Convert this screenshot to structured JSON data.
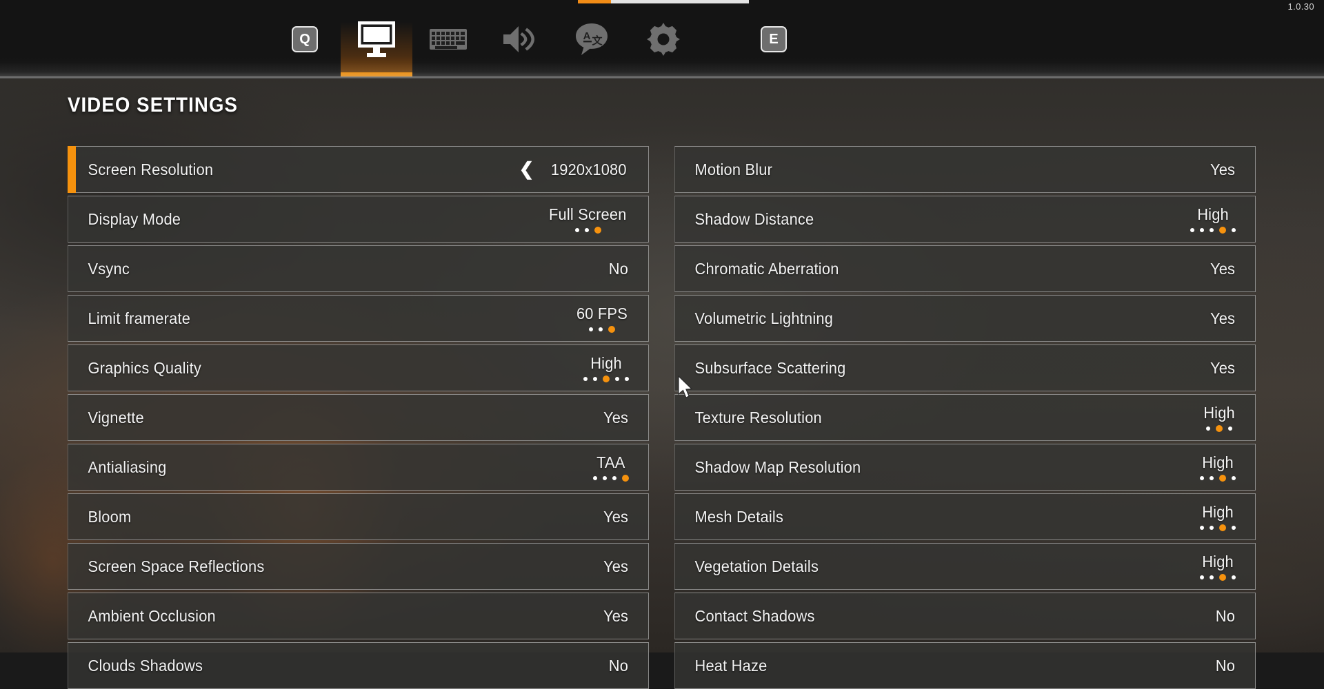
{
  "version": "1.0.30",
  "topbar": {
    "tabs": [
      {
        "name": "quit-keycap",
        "icon": "keycap-q",
        "label": "Q",
        "active": false
      },
      {
        "name": "tab-video",
        "icon": "monitor-icon",
        "label": "",
        "active": true
      },
      {
        "name": "tab-controls",
        "icon": "keyboard-icon",
        "label": "",
        "active": false
      },
      {
        "name": "tab-audio",
        "icon": "speaker-icon",
        "label": "",
        "active": false
      },
      {
        "name": "tab-language",
        "icon": "language-icon",
        "label": "",
        "active": false
      },
      {
        "name": "tab-gameplay",
        "icon": "gear-icon",
        "label": "",
        "active": false
      },
      {
        "name": "next-keycap",
        "icon": "keycap-e",
        "label": "E",
        "active": false
      }
    ]
  },
  "page": {
    "title": "VIDEO SETTINGS",
    "accent_color": "#f6920e",
    "left_column": [
      {
        "label": "Screen Resolution",
        "value": "1920x1080",
        "chevron": true,
        "selected": true,
        "dots": 0,
        "dot_index": 0
      },
      {
        "label": "Display Mode",
        "value": "Full Screen",
        "chevron": false,
        "selected": false,
        "dots": 3,
        "dot_index": 3
      },
      {
        "label": "Vsync",
        "value": "No",
        "chevron": false,
        "selected": false,
        "dots": 0,
        "dot_index": 0
      },
      {
        "label": "Limit framerate",
        "value": "60 FPS",
        "chevron": false,
        "selected": false,
        "dots": 3,
        "dot_index": 3
      },
      {
        "label": "Graphics Quality",
        "value": "High",
        "chevron": false,
        "selected": false,
        "dots": 5,
        "dot_index": 3
      },
      {
        "label": "Vignette",
        "value": "Yes",
        "chevron": false,
        "selected": false,
        "dots": 0,
        "dot_index": 0
      },
      {
        "label": "Antialiasing",
        "value": "TAA",
        "chevron": false,
        "selected": false,
        "dots": 4,
        "dot_index": 4
      },
      {
        "label": "Bloom",
        "value": "Yes",
        "chevron": false,
        "selected": false,
        "dots": 0,
        "dot_index": 0
      },
      {
        "label": "Screen Space Reflections",
        "value": "Yes",
        "chevron": false,
        "selected": false,
        "dots": 0,
        "dot_index": 0
      },
      {
        "label": "Ambient Occlusion",
        "value": "Yes",
        "chevron": false,
        "selected": false,
        "dots": 0,
        "dot_index": 0
      },
      {
        "label": "Clouds Shadows",
        "value": "No",
        "chevron": false,
        "selected": false,
        "dots": 0,
        "dot_index": 0
      }
    ],
    "right_column": [
      {
        "label": "Motion Blur",
        "value": "Yes",
        "chevron": false,
        "selected": false,
        "dots": 0,
        "dot_index": 0
      },
      {
        "label": "Shadow Distance",
        "value": "High",
        "chevron": false,
        "selected": false,
        "dots": 5,
        "dot_index": 4
      },
      {
        "label": "Chromatic Aberration",
        "value": "Yes",
        "chevron": false,
        "selected": false,
        "dots": 0,
        "dot_index": 0
      },
      {
        "label": "Volumetric Lightning",
        "value": "Yes",
        "chevron": false,
        "selected": false,
        "dots": 0,
        "dot_index": 0
      },
      {
        "label": "Subsurface Scattering",
        "value": "Yes",
        "chevron": false,
        "selected": false,
        "dots": 0,
        "dot_index": 0
      },
      {
        "label": "Texture Resolution",
        "value": "High",
        "chevron": false,
        "selected": false,
        "dots": 3,
        "dot_index": 2
      },
      {
        "label": "Shadow Map Resolution",
        "value": "High",
        "chevron": false,
        "selected": false,
        "dots": 4,
        "dot_index": 3
      },
      {
        "label": "Mesh Details",
        "value": "High",
        "chevron": false,
        "selected": false,
        "dots": 4,
        "dot_index": 3
      },
      {
        "label": "Vegetation Details",
        "value": "High",
        "chevron": false,
        "selected": false,
        "dots": 4,
        "dot_index": 3
      },
      {
        "label": "Contact Shadows",
        "value": "No",
        "chevron": false,
        "selected": false,
        "dots": 0,
        "dot_index": 0
      },
      {
        "label": "Heat Haze",
        "value": "No",
        "chevron": false,
        "selected": false,
        "dots": 0,
        "dot_index": 0
      }
    ]
  }
}
